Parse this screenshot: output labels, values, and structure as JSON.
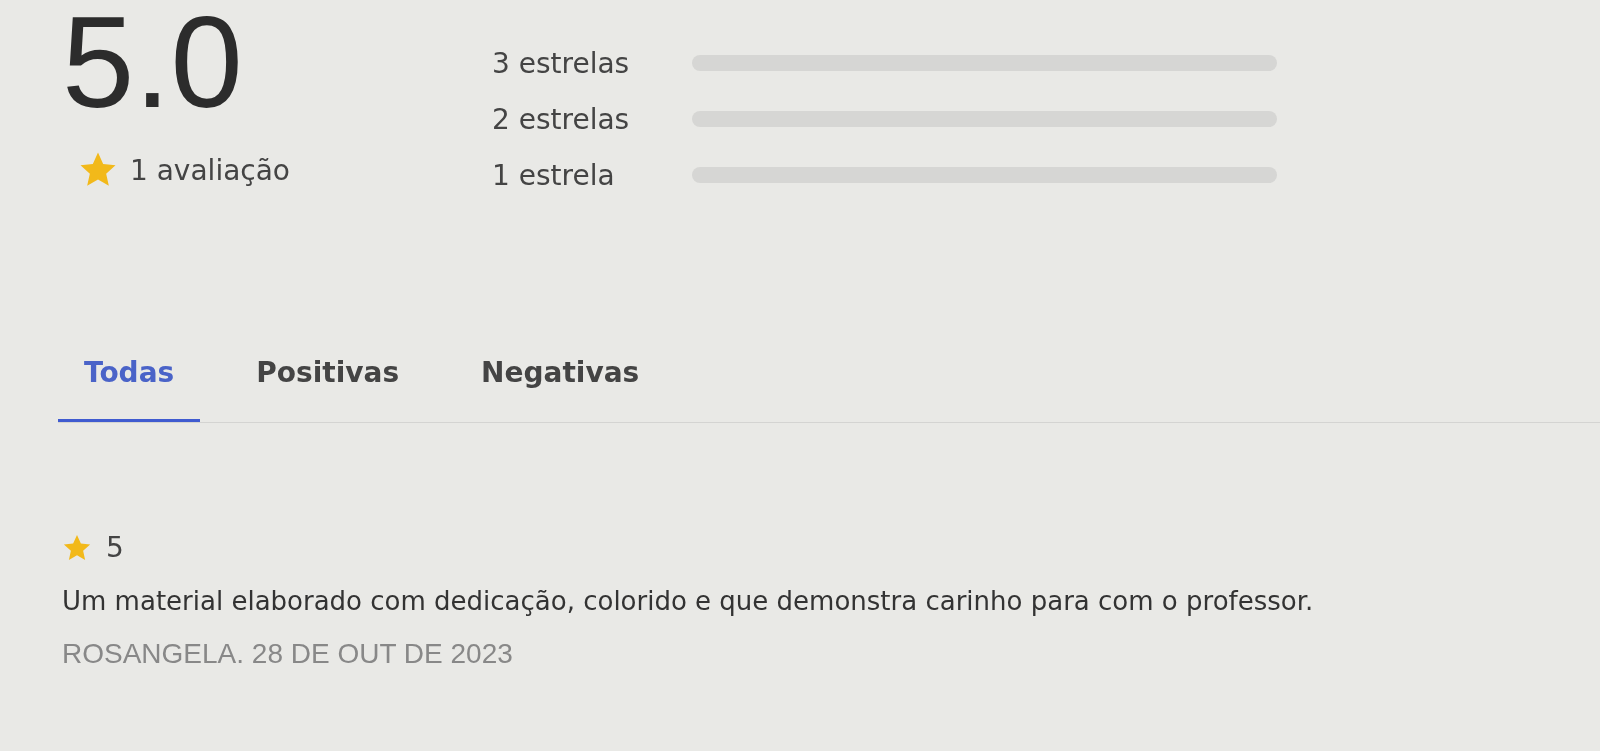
{
  "summary": {
    "average": "5.0",
    "count": "1 avaliação"
  },
  "distribution": [
    {
      "label": "3 estrelas",
      "level": 0
    },
    {
      "label": "2 estrelas",
      "level": 0
    },
    {
      "label": "1 estrela",
      "level": 0
    }
  ],
  "tabs": [
    {
      "label": "Todas",
      "selected": true
    },
    {
      "label": "Positivas",
      "selected": false
    },
    {
      "label": "Negativas",
      "selected": false
    }
  ],
  "reviews": [
    {
      "rating": "5",
      "text": "Um material elaborado com dedicação, colorido e que demonstra carinho para com o professor.",
      "author": "ROSANGELA. 28 DE OUT DE 2023"
    }
  ]
}
